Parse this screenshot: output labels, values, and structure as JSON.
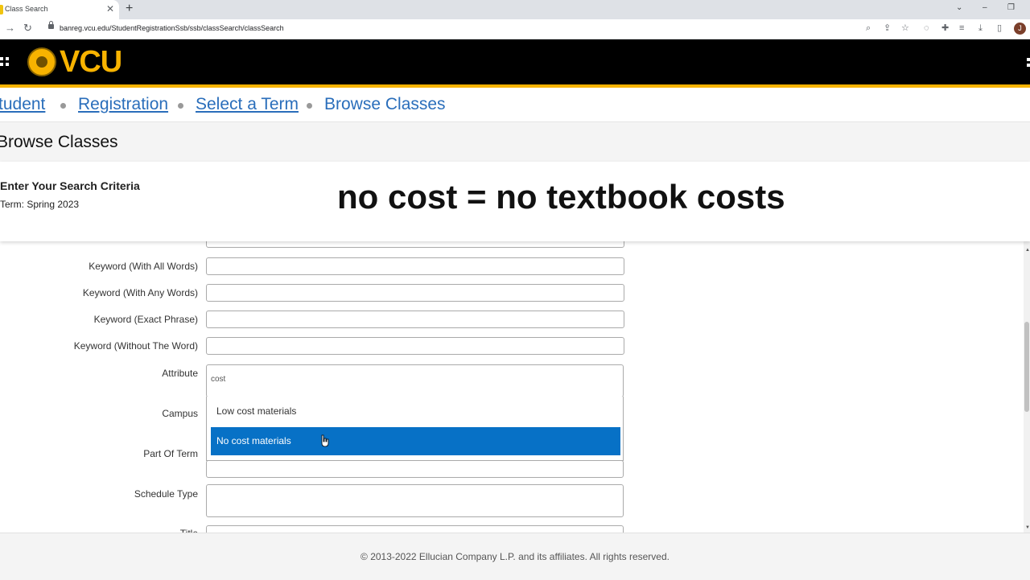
{
  "browser": {
    "tab_title": "Class Search",
    "tab_close": "✕",
    "new_tab": "+",
    "url": "banreg.vcu.edu/StudentRegistrationSsb/ssb/classSearch/classSearch",
    "profile_initial": "J",
    "win_controls": [
      "⌄",
      "–",
      "❐"
    ]
  },
  "header": {
    "logo_text": "VCU",
    "brand_color": "#f8b300"
  },
  "breadcrumb": {
    "items": [
      "tudent",
      "Registration",
      "Select a Term"
    ],
    "current": "Browse Classes"
  },
  "page": {
    "title": "Browse Classes"
  },
  "search": {
    "heading": "Enter Your Search Criteria",
    "term": "Term: Spring 2023"
  },
  "caption": "no cost = no textbook costs",
  "form": {
    "keyword_all": "Keyword (With All Words)",
    "keyword_any": "Keyword (With Any Words)",
    "keyword_exact": "Keyword (Exact Phrase)",
    "keyword_without": "Keyword (Without The Word)",
    "attribute_label": "Attribute",
    "attribute_value": "cost",
    "attribute_options": [
      "Low cost materials",
      "No cost materials"
    ],
    "attribute_selected": "No cost materials",
    "campus": "Campus",
    "part_of_term": "Part Of Term",
    "schedule_type": "Schedule Type",
    "title": "Title"
  },
  "footer": {
    "copyright": "© 2013-2022 Ellucian Company L.P. and its affiliates. All rights reserved."
  }
}
